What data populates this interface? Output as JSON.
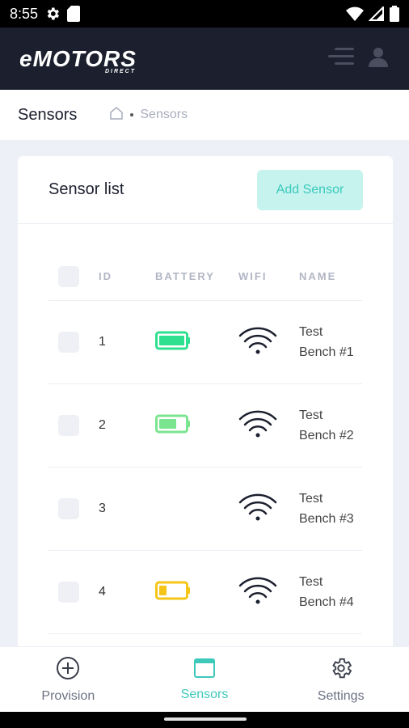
{
  "status_bar": {
    "time": "8:55",
    "icons": [
      "gear-icon",
      "sd-card-icon",
      "wifi-icon",
      "signal-icon",
      "battery-icon"
    ]
  },
  "header": {
    "logo_main": "eMOTORS",
    "logo_sub": "DIRECT",
    "icons": [
      "menu-icon",
      "user-icon"
    ]
  },
  "page": {
    "title": "Sensors",
    "breadcrumb": {
      "home_icon": "home-icon",
      "current": "Sensors"
    }
  },
  "card": {
    "title": "Sensor list",
    "add_button": "Add Sensor"
  },
  "table": {
    "columns": [
      "ID",
      "BATTERY",
      "WIFI",
      "NAME"
    ],
    "rows": [
      {
        "id": "1",
        "battery_level": 1.0,
        "battery_color": "#2fe08f",
        "wifi": "wifi-icon",
        "name": "Test Bench #1"
      },
      {
        "id": "2",
        "battery_level": 0.7,
        "battery_color": "#7be48f",
        "wifi": "wifi-icon",
        "name": "Test Bench #2"
      },
      {
        "id": "3",
        "battery_level": null,
        "battery_color": null,
        "wifi": "wifi-icon",
        "name": "Test Bench #3"
      },
      {
        "id": "4",
        "battery_level": 0.35,
        "battery_color": "#f5c518",
        "wifi": "wifi-icon",
        "name": "Test Bench #4"
      }
    ]
  },
  "bottom_nav": {
    "items": [
      {
        "label": "Provision",
        "icon": "plus-circle-icon",
        "active": false
      },
      {
        "label": "Sensors",
        "icon": "window-icon",
        "active": true
      },
      {
        "label": "Settings",
        "icon": "gear-icon",
        "active": false
      }
    ]
  },
  "colors": {
    "header_bg": "#1c1f2e",
    "accent": "#3ec8ba",
    "accent_bg": "#c7f3ef",
    "page_bg": "#eef0f8"
  }
}
